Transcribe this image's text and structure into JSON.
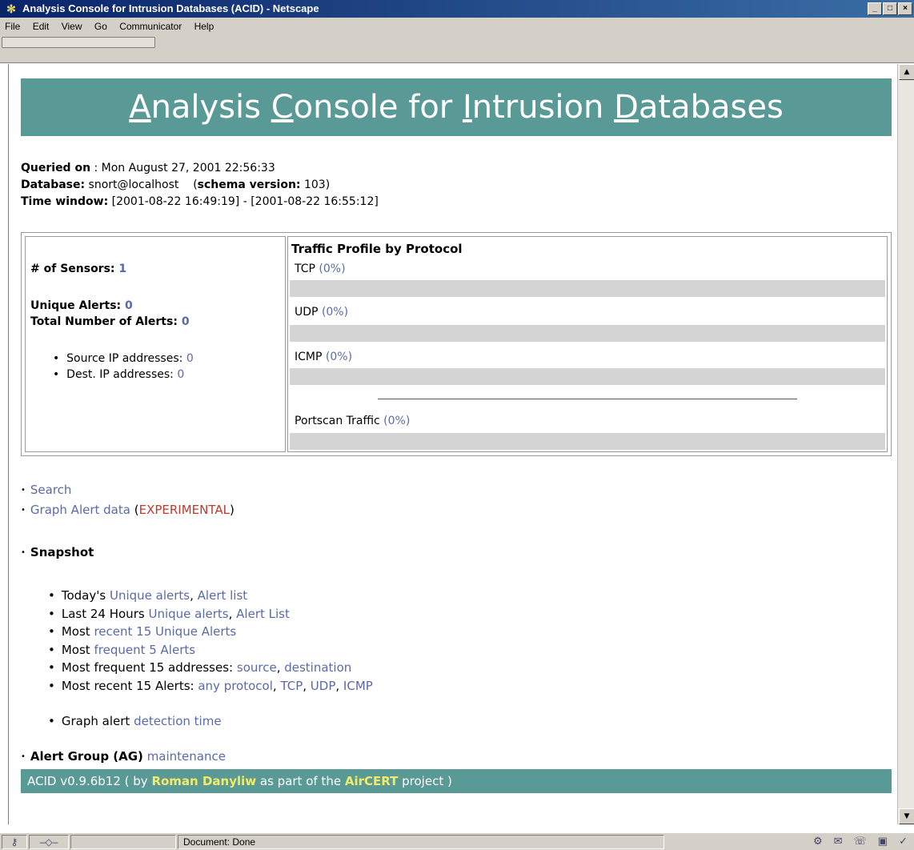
{
  "window": {
    "title": "Analysis Console for Intrusion Databases (ACID) - Netscape",
    "controls": [
      "_",
      "□",
      "×"
    ]
  },
  "menu": [
    "File",
    "Edit",
    "View",
    "Go",
    "Communicator",
    "Help"
  ],
  "banner": {
    "parts": [
      {
        "u": "A",
        "rest": "nalysis "
      },
      {
        "u": "C",
        "rest": "onsole for "
      },
      {
        "u": "I",
        "rest": "ntrusion "
      },
      {
        "u": "D",
        "rest": "atabases"
      }
    ]
  },
  "meta": {
    "queried_label": "Queried on",
    "queried_value": " : Mon August 27, 2001 22:56:33",
    "database_label": "Database:",
    "database_value": " snort@localhost",
    "schema_label": "schema version:",
    "schema_value": " 103)",
    "schema_open": "(",
    "time_label": "Time window:",
    "time_value": " [2001-08-22 16:49:19] - [2001-08-22 16:55:12]"
  },
  "stats": {
    "sensors_label": "# of Sensors:",
    "sensors_value": "1",
    "unique_label": "Unique Alerts:",
    "unique_value": "0",
    "total_label": "Total Number of Alerts:",
    "total_value": "0",
    "src_label": "Source IP addresses:",
    "src_value": "0",
    "dst_label": "Dest. IP addresses:",
    "dst_value": "0"
  },
  "traffic": {
    "title": "Traffic Profile by Protocol",
    "rows": [
      {
        "name": "TCP",
        "pct": "(0%)",
        "level": 0
      },
      {
        "name": "UDP",
        "pct": "(0%)",
        "level": 0
      },
      {
        "name": "ICMP",
        "pct": "(0%)",
        "level": 0
      }
    ],
    "portscan": {
      "name": "Portscan Traffic",
      "pct": "(0%)",
      "level": 0
    }
  },
  "links": {
    "search": "Search",
    "graph": "Graph Alert data",
    "experimental": "EXPERIMENTAL",
    "open_paren": "(",
    "close_paren": ")",
    "snapshot": "Snapshot",
    "ag_label": "Alert Group (AG)",
    "ag_link": "maintenance"
  },
  "snapshot": {
    "today_prefix": "Today's",
    "today_unique": "Unique alerts",
    "today_list": "Alert list",
    "last24_prefix": "Last 24 Hours",
    "last24_unique": "Unique alerts",
    "last24_list": "Alert List",
    "recent_prefix": "Most",
    "recent_link": "recent 15 Unique Alerts",
    "freq_prefix": "Most",
    "freq_link": "frequent 5 Alerts",
    "addr_prefix": "Most frequent 15 addresses:",
    "addr_source": "source",
    "addr_dest": "destination",
    "recent15_prefix": "Most recent 15 Alerts:",
    "recent15_any": "any protocol",
    "recent15_tcp": "TCP",
    "recent15_udp": "UDP",
    "recent15_icmp": "ICMP",
    "graph_prefix": "Graph alert",
    "graph_link": "detection time"
  },
  "footer": {
    "prefix": "ACID v0.9.6b12 ( by",
    "author": "Roman Danyliw",
    "middle": "as part of the",
    "project": "AirCERT",
    "suffix": "project )"
  },
  "status": {
    "text": "Document: Done"
  },
  "colors": {
    "accent": "#5a9a96",
    "link": "#5a6aa8",
    "experimental": "#c0392b",
    "footer_highlight": "#f2ea6a"
  }
}
